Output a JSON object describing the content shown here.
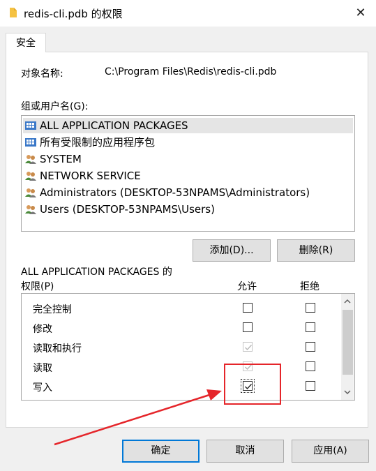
{
  "window": {
    "title": "redis-cli.pdb 的权限",
    "close_glyph": "✕"
  },
  "tabs": [
    {
      "label": "安全"
    }
  ],
  "object": {
    "label": "对象名称:",
    "value": "C:\\Program Files\\Redis\\redis-cli.pdb"
  },
  "groups": {
    "label": "组或用户名(G):",
    "items": [
      {
        "name": "ALL APPLICATION PACKAGES",
        "icon": "package-group-icon",
        "selected": true
      },
      {
        "name": "所有受限制的应用程序包",
        "icon": "package-group-icon",
        "selected": false
      },
      {
        "name": "SYSTEM",
        "icon": "users-icon",
        "selected": false
      },
      {
        "name": "NETWORK SERVICE",
        "icon": "users-icon",
        "selected": false
      },
      {
        "name": "Administrators (DESKTOP-53NPAMS\\Administrators)",
        "icon": "users-icon",
        "selected": false
      },
      {
        "name": "Users (DESKTOP-53NPAMS\\Users)",
        "icon": "users-icon",
        "selected": false
      }
    ],
    "add_button": "添加(D)...",
    "remove_button": "删除(R)"
  },
  "permissions": {
    "header_line1": "ALL APPLICATION PACKAGES 的",
    "header_line2": "权限(P)",
    "allow_header": "允许",
    "deny_header": "拒绝",
    "rows": [
      {
        "name": "完全控制",
        "allow": false,
        "allow_disabled": false,
        "deny": false
      },
      {
        "name": "修改",
        "allow": false,
        "allow_disabled": false,
        "deny": false
      },
      {
        "name": "读取和执行",
        "allow": true,
        "allow_disabled": true,
        "deny": false
      },
      {
        "name": "读取",
        "allow": true,
        "allow_disabled": true,
        "deny": false
      },
      {
        "name": "写入",
        "allow": true,
        "allow_disabled": false,
        "deny": false
      }
    ]
  },
  "buttons": {
    "ok": "确定",
    "cancel": "取消",
    "apply": "应用(A)"
  },
  "colors": {
    "annotation": "#e5252a",
    "primary_border": "#0078d7"
  }
}
